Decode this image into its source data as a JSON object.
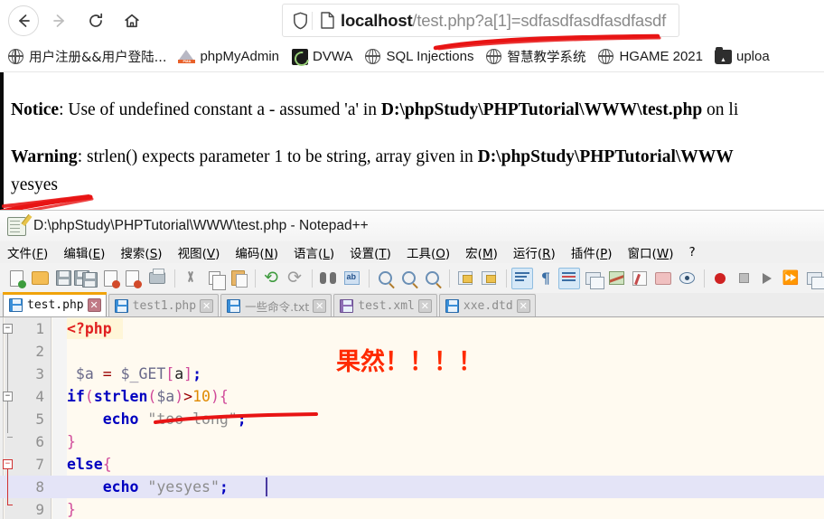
{
  "browser": {
    "nav": {
      "back_icon": "arrow-left-icon",
      "forward_icon": "arrow-right-icon",
      "reload_icon": "reload-icon",
      "home_icon": "home-icon"
    },
    "address_bar": {
      "shield_icon": "shield-icon",
      "page_icon": "page-icon",
      "host": "localhost",
      "path_query": "/test.php?a[1]=sdfasdfasdfasdfasdf",
      "full_url": "localhost/test.php?a[1]=sdfasdfasdfasdfasdf"
    },
    "bookmarks": [
      {
        "label": "用户注册&&用户登陆...",
        "icon": "globe-icon",
        "cjk": true
      },
      {
        "label": "phpMyAdmin",
        "icon": "phpmyadmin-icon",
        "cjk": false
      },
      {
        "label": "DVWA",
        "icon": "dvwa-icon",
        "cjk": false
      },
      {
        "label": "SQL Injections",
        "icon": "globe-icon",
        "cjk": false
      },
      {
        "label": "智慧教学系统",
        "icon": "globe-icon",
        "cjk": true
      },
      {
        "label": "HGAME 2021",
        "icon": "globe-icon",
        "cjk": false
      },
      {
        "label": "uploa",
        "icon": "upload-labs-icon",
        "cjk": false
      }
    ]
  },
  "page_output": {
    "notice": {
      "head": "Notice",
      "body_before": ": Use of undefined constant a - assumed 'a' in ",
      "path": "D:\\phpStudy\\PHPTutorial\\WWW\\test.php",
      "body_after": " on li"
    },
    "warning": {
      "head": "Warning",
      "body_before": ": strlen() expects parameter 1 to be string, array given in ",
      "path": "D:\\phpStudy\\PHPTutorial\\WWW",
      "body_after": ""
    },
    "result": "yesyes"
  },
  "notepad": {
    "title": "D:\\phpStudy\\PHPTutorial\\WWW\\test.php - Notepad++",
    "title_icon": "notepad-plus-plus-icon",
    "menu": [
      {
        "text": "文件",
        "key": "F"
      },
      {
        "text": "编辑",
        "key": "E"
      },
      {
        "text": "搜索",
        "key": "S"
      },
      {
        "text": "视图",
        "key": "V"
      },
      {
        "text": "编码",
        "key": "N"
      },
      {
        "text": "语言",
        "key": "L"
      },
      {
        "text": "设置",
        "key": "T"
      },
      {
        "text": "工具",
        "key": "O"
      },
      {
        "text": "宏",
        "key": "M"
      },
      {
        "text": "运行",
        "key": "R"
      },
      {
        "text": "插件",
        "key": "P"
      },
      {
        "text": "窗口",
        "key": "W"
      },
      {
        "text": "?",
        "key": ""
      }
    ],
    "toolbar": [
      "new-file-icon",
      "open-file-icon",
      "save-icon",
      "save-all-icon",
      "close-file-icon",
      "close-all-icon",
      "print-icon",
      "sep",
      "cut-icon",
      "copy-icon",
      "paste-icon",
      "sep",
      "undo-icon",
      "redo-icon",
      "sep",
      "find-icon",
      "replace-icon",
      "sep",
      "zoom-in-icon",
      "zoom-out-icon",
      "sep",
      "sync-vertical-icon",
      "sync-horizontal-icon",
      "sep",
      "word-wrap-icon",
      "show-all-chars-icon",
      "indent-guide-icon",
      "ui-style-icon",
      "document-map-icon",
      "function-list-icon",
      "folder-as-workspace-icon",
      "monitor-icon",
      "sep",
      "record-macro-icon",
      "stop-macro-icon",
      "play-macro-icon",
      "fast-playback-icon",
      "save-macro-icon"
    ],
    "tabs": [
      {
        "label": "test.php",
        "active": true,
        "cjk": false,
        "icon": "floppy-blue-icon"
      },
      {
        "label": "test1.php",
        "active": false,
        "cjk": false,
        "icon": "floppy-blue-icon"
      },
      {
        "label": "一些命令.txt",
        "active": false,
        "cjk": true,
        "icon": "floppy-blue-icon"
      },
      {
        "label": "test.xml",
        "active": false,
        "cjk": false,
        "icon": "floppy-violet-icon"
      },
      {
        "label": "xxe.dtd",
        "active": false,
        "cjk": false,
        "icon": "floppy-blue-icon"
      }
    ],
    "close_glyph": "✕",
    "editor": {
      "line_numbers": [
        "1",
        "2",
        "3",
        "4",
        "5",
        "6",
        "7",
        "8",
        "9"
      ],
      "lines": [
        "<?php",
        "",
        " $a = $_GET[a];",
        "if(strlen($a)>10){",
        "    echo \"too long\";",
        "}",
        "else{",
        "    echo \"yesyes\";",
        "}"
      ],
      "annotation": "果然！！！！",
      "annotation_color": "#ff2a00",
      "current_line": 8
    }
  },
  "colors": {
    "marker_red": "#e81414",
    "tab_accent": "#f0a30a",
    "editor_bg": "#fffaf0"
  }
}
